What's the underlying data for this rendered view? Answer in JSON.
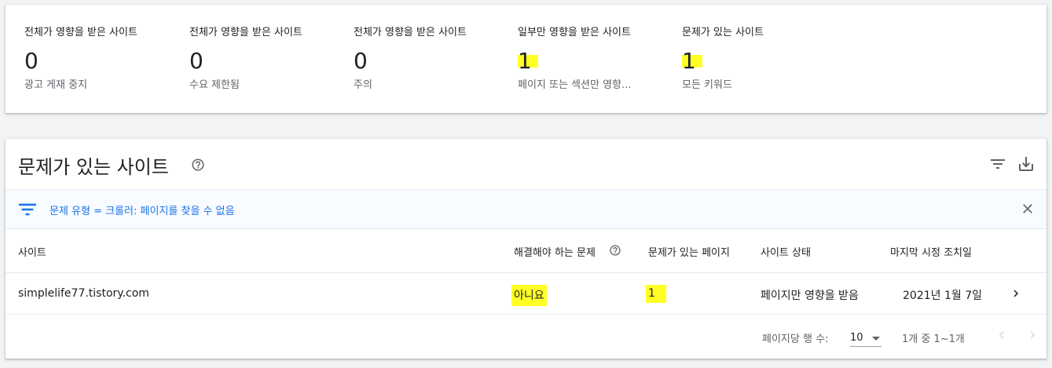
{
  "summary": {
    "stats": [
      {
        "title": "전체가 영향을 받은 사이트",
        "value": "0",
        "sub": "광고 게재 중지",
        "highlighted": false
      },
      {
        "title": "전체가 영향을 받은 사이트",
        "value": "0",
        "sub": "수요 제한됨",
        "highlighted": false
      },
      {
        "title": "전체가 영향을 받은 사이트",
        "value": "0",
        "sub": "주의",
        "highlighted": false
      },
      {
        "title": "일부만 영향을 받은 사이트",
        "value": "1",
        "sub": "페이지 또는 섹션만 영향...",
        "highlighted": true
      },
      {
        "title": "문제가 있는 사이트",
        "value": "1",
        "sub": "모든 키워드",
        "highlighted": true
      }
    ]
  },
  "table_card": {
    "title": "문제가 있는 사이트",
    "help_icon": "help-circle-icon",
    "filter_icon": "filter-list-icon",
    "download_icon": "download-icon",
    "filter": {
      "text": "문제 유형 = 크롤러: 페이지를 찾을 수 없음",
      "icon": "filter-list-icon",
      "close_icon": "close-icon"
    },
    "columns": [
      "사이트",
      "해결해야 하는 문제",
      "문제가 있는 페이지",
      "사이트 상태",
      "마지막 시정 조치일"
    ],
    "rows": [
      {
        "site": "simplelife77.tistory.com",
        "must_fix": "아니요",
        "pages": "1",
        "status": "페이지만 영향을 받음",
        "last_action": "2021년 1월 7일"
      }
    ],
    "pagination": {
      "rows_per_page_label": "페이지당 행 수:",
      "rows_per_page": "10",
      "range": "1개 중 1~1개"
    }
  },
  "colors": {
    "accent": "#1a73e8",
    "highlight": "#ffff00",
    "text": "#202124",
    "secondary_text": "#5f6368"
  }
}
